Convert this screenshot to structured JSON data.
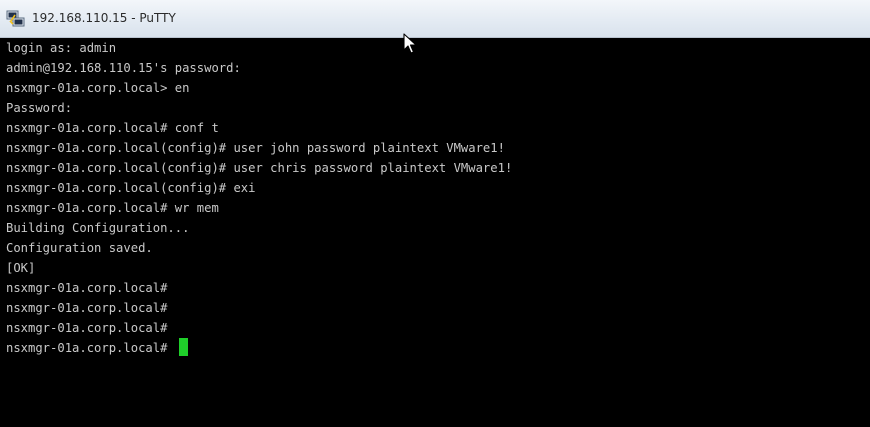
{
  "window": {
    "title": "192.168.110.15 - PuTTY",
    "icon": "putty-icon"
  },
  "terminal": {
    "lines": [
      "login as: admin",
      "admin@192.168.110.15's password:",
      "nsxmgr-01a.corp.local> en",
      "Password:",
      "nsxmgr-01a.corp.local# conf t",
      "nsxmgr-01a.corp.local(config)# user john password plaintext VMware1!",
      "nsxmgr-01a.corp.local(config)# user chris password plaintext VMware1!",
      "nsxmgr-01a.corp.local(config)# exi",
      "nsxmgr-01a.corp.local# wr mem",
      "Building Configuration...",
      "Configuration saved.",
      "[OK]",
      "nsxmgr-01a.corp.local#",
      "nsxmgr-01a.corp.local#",
      "nsxmgr-01a.corp.local#",
      "nsxmgr-01a.corp.local# "
    ],
    "cursor_color": "#1fcf2a",
    "text_color": "#c9c9c9",
    "background_color": "#000000"
  }
}
